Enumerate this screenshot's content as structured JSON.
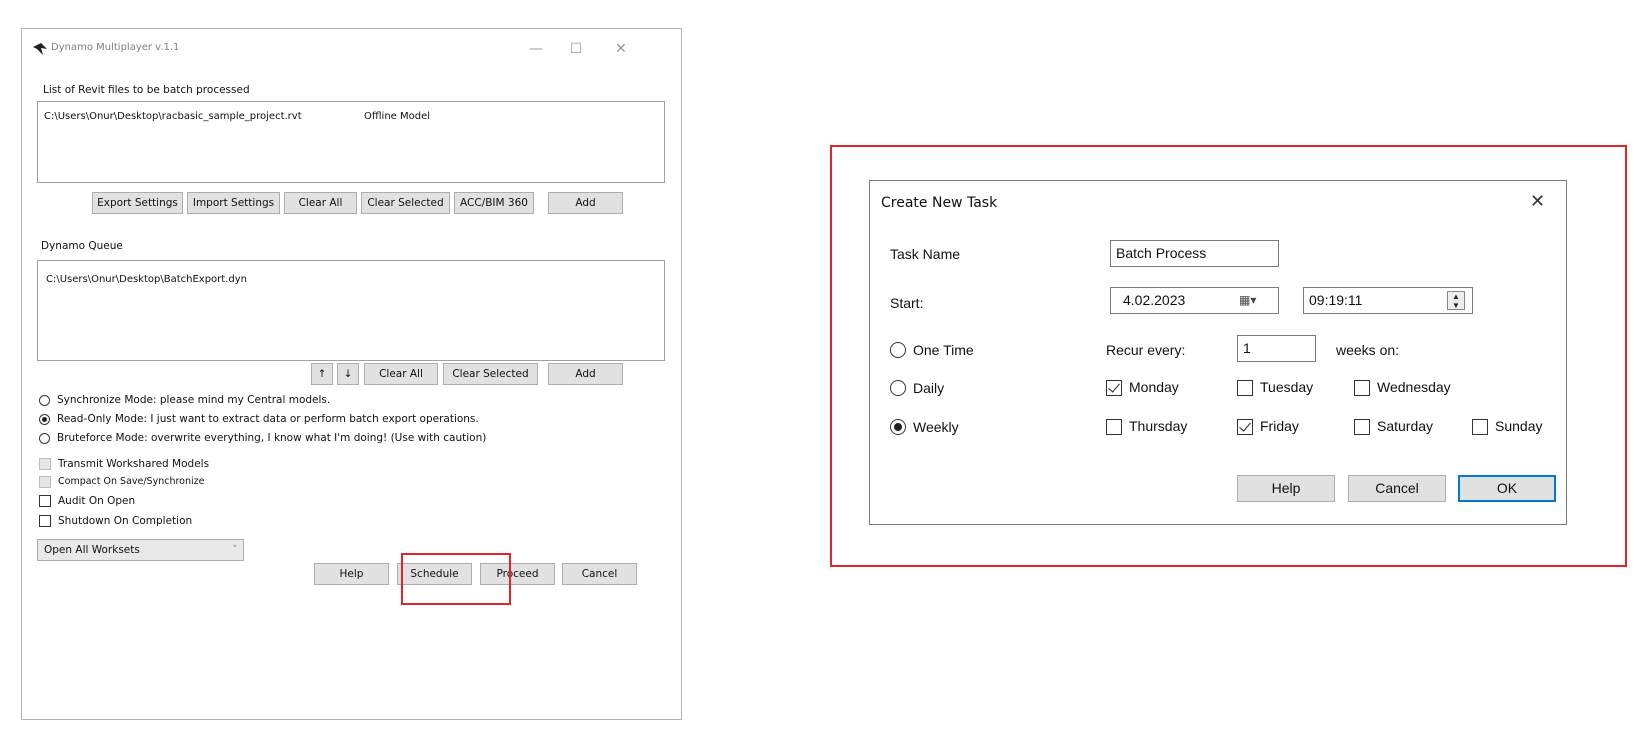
{
  "main_window": {
    "title": "Dynamo Multiplayer v.1.1",
    "controls": {
      "minimize": "—",
      "maximize": "☐",
      "close": "✕"
    },
    "revit_files": {
      "label": "List of Revit files to be batch processed",
      "items": [
        {
          "path": "C:\\Users\\Onur\\Desktop\\racbasic_sample_project.rvt",
          "status": "Offline Model"
        }
      ]
    },
    "file_buttons": {
      "export_settings": "Export Settings",
      "import_settings": "Import Settings",
      "clear_all": "Clear All",
      "clear_selected": "Clear Selected",
      "acc_bim360": "ACC/BIM 360",
      "add": "Add"
    },
    "dynamo_queue": {
      "label": "Dynamo Queue",
      "items": [
        "C:\\Users\\Onur\\Desktop\\BatchExport.dyn"
      ]
    },
    "queue_buttons": {
      "up": "↑",
      "down": "↓",
      "clear_all": "Clear All",
      "clear_selected": "Clear Selected",
      "add": "Add"
    },
    "modes": [
      {
        "label": "Synchronize Mode: please mind my Central models.",
        "selected": false
      },
      {
        "label": "Read-Only Mode: I just want to extract data or perform batch export operations.",
        "selected": true
      },
      {
        "label": "Bruteforce Mode: overwrite everything, I know what I'm doing! (Use with caution)",
        "selected": false
      }
    ],
    "options": [
      {
        "label": "Transmit Workshared Models",
        "checked": false,
        "disabled": true
      },
      {
        "label": "Compact On Save/Synchronize",
        "checked": false,
        "disabled": true
      },
      {
        "label": "Audit On Open",
        "checked": false,
        "disabled": false
      },
      {
        "label": "Shutdown On Completion",
        "checked": false,
        "disabled": false
      }
    ],
    "worksets_dropdown": {
      "value": "Open All Worksets"
    },
    "bottom_buttons": {
      "help": "Help",
      "schedule": "Schedule",
      "proceed": "Proceed",
      "cancel": "Cancel"
    }
  },
  "dialog": {
    "title": "Create New Task",
    "close": "✕",
    "task_name_label": "Task Name",
    "task_name_value": "Batch Process",
    "start_label": "Start:",
    "start_date": "4.02.2023",
    "start_time": "09:19:11",
    "frequencies": [
      {
        "label": "One Time",
        "selected": false
      },
      {
        "label": "Daily",
        "selected": false
      },
      {
        "label": "Weekly",
        "selected": true
      }
    ],
    "recur_label": "Recur every:",
    "recur_value": "1",
    "weeks_on_label": "weeks on:",
    "days": [
      {
        "label": "Monday",
        "checked": true
      },
      {
        "label": "Tuesday",
        "checked": false
      },
      {
        "label": "Wednesday",
        "checked": false
      },
      {
        "label": "Thursday",
        "checked": false
      },
      {
        "label": "Friday",
        "checked": true
      },
      {
        "label": "Saturday",
        "checked": false
      },
      {
        "label": "Sunday",
        "checked": false
      }
    ],
    "buttons": {
      "help": "Help",
      "cancel": "Cancel",
      "ok": "OK"
    }
  },
  "colors": {
    "highlight_red": "#e3232a",
    "accent_blue": "#0078d7",
    "button_gray": "#e1e1e1"
  }
}
